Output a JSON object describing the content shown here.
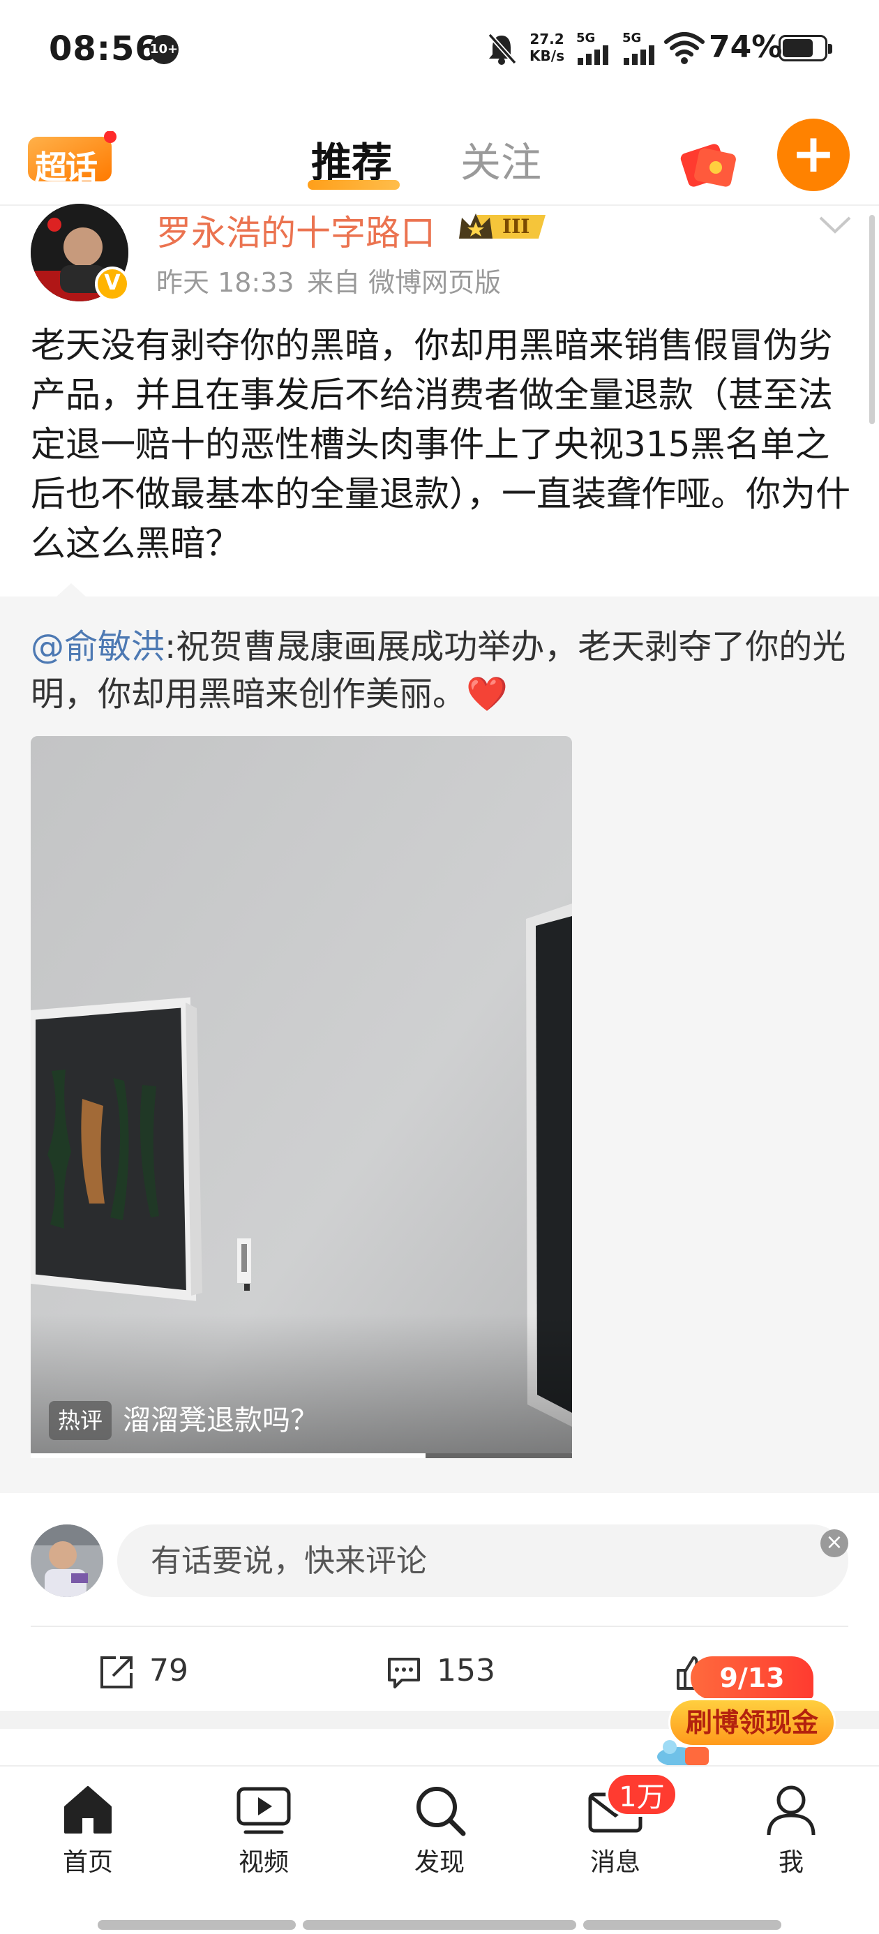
{
  "status_bar": {
    "time": "08:56",
    "notif_count": "10+",
    "net_speed_value": "27.2",
    "net_speed_unit": "KB/s",
    "signal1": "5G",
    "signal2": "5G",
    "battery": "74%",
    "battery_level": 0.74
  },
  "top_nav": {
    "logo_text": "超话",
    "tab_recommend": "推荐",
    "tab_follow": "关注",
    "accent": "#ff8200"
  },
  "post": {
    "author": "罗永浩的十字路口",
    "rank": "III",
    "time": "昨天 18:33",
    "source": "来自 微博网页版",
    "text": "老天没有剥夺你的黑暗，你却用黑暗来销售假冒伪劣产品，并且在事发后不给消费者做全量退款（甚至法定退一赔十的恶性槽头肉事件上了央视315黑名单之后也不做最基本的全量退款），一直装聋作哑。你为什么这么黑暗？",
    "author_color": "#eb7350"
  },
  "repost": {
    "mention": "@俞敏洪",
    "text": ":祝贺曹晟康画展成功举办，老天剥夺了你的光明，你却用黑暗来创作美丽。",
    "heart": "❤️",
    "hot_tag": "热评",
    "hot_comment": "溜溜凳退款吗？",
    "video_progress": 0.73
  },
  "comment_box": {
    "placeholder": "有话要说，快来评论"
  },
  "actions": {
    "repost_count": "79",
    "comment_count": "153"
  },
  "promo": {
    "count": "9/13",
    "label": "刷博领现金"
  },
  "bottom_nav": {
    "items": [
      {
        "label": "首页",
        "icon": "home-icon"
      },
      {
        "label": "视频",
        "icon": "video-icon"
      },
      {
        "label": "发现",
        "icon": "search-icon"
      },
      {
        "label": "消息",
        "icon": "mail-icon"
      },
      {
        "label": "我",
        "icon": "user-icon"
      }
    ],
    "msg_badge": "1万"
  }
}
